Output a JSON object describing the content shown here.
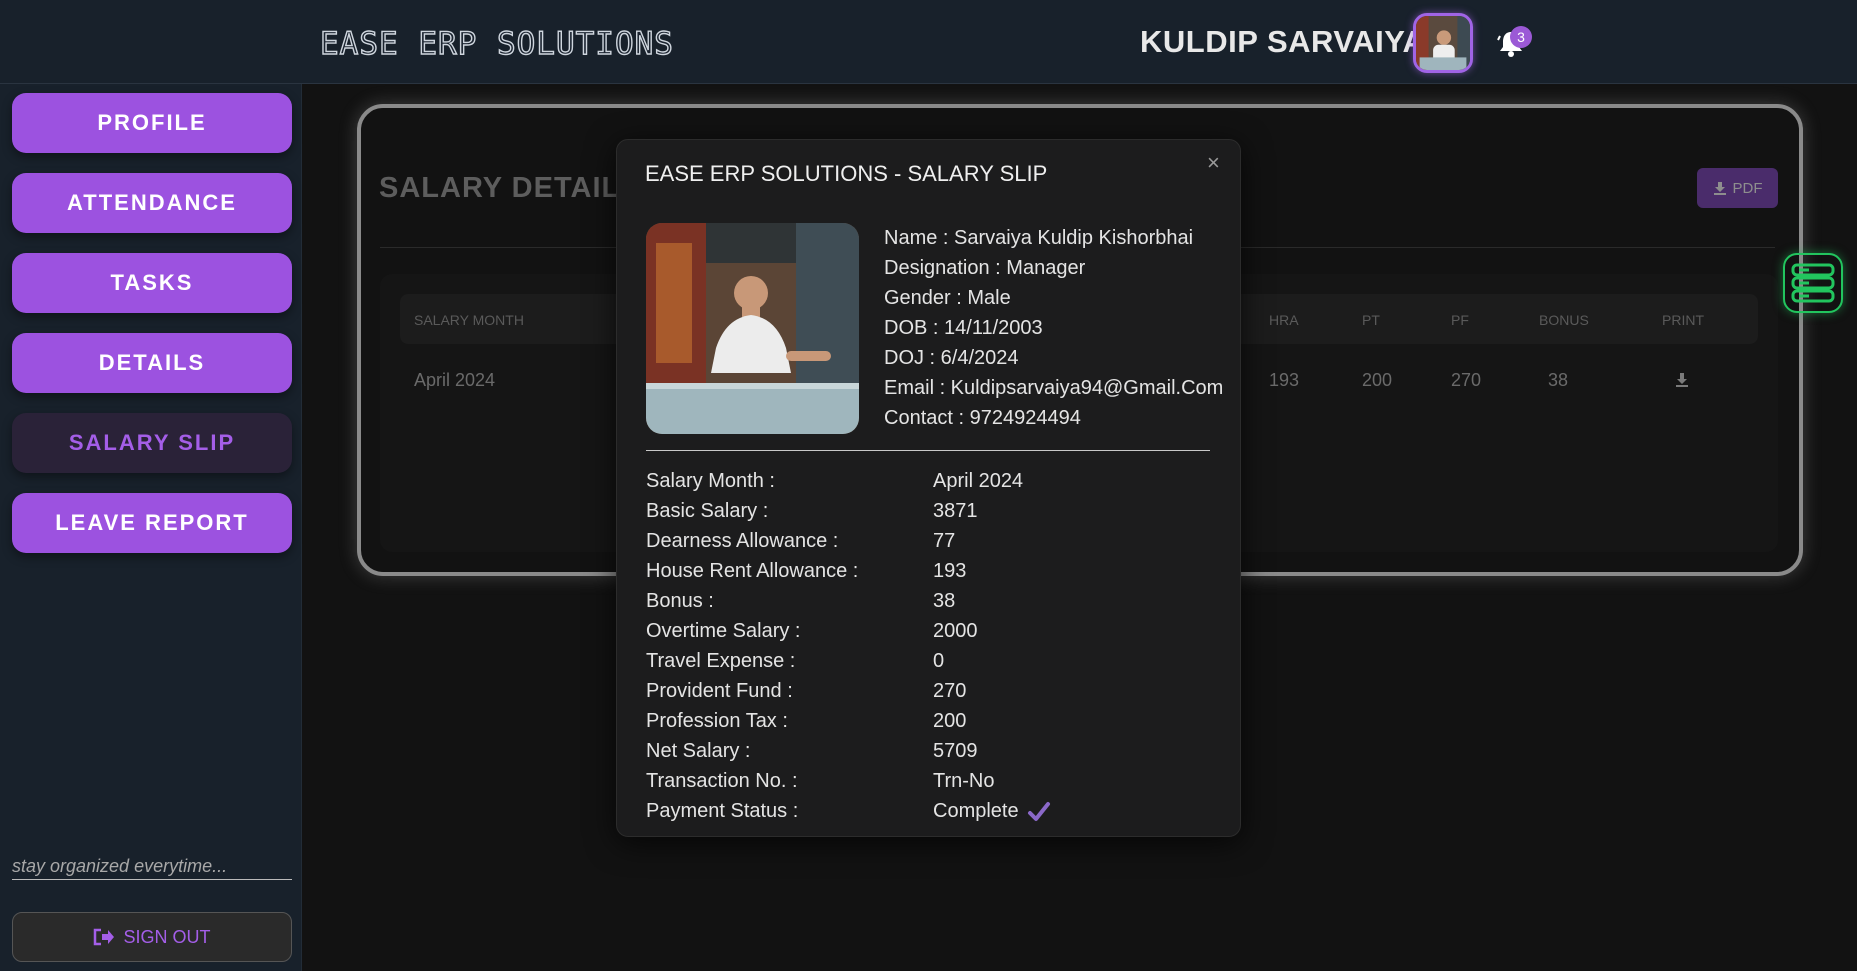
{
  "header": {
    "logo": "EASE ERP SOLUTIONS",
    "username": "KULDIP SARVAIYA",
    "notification_count": "3"
  },
  "sidebar": {
    "items": [
      {
        "label": "PROFILE"
      },
      {
        "label": "ATTENDANCE"
      },
      {
        "label": "TASKS"
      },
      {
        "label": "DETAILS"
      },
      {
        "label": "SALARY SLIP"
      },
      {
        "label": "LEAVE REPORT"
      }
    ],
    "tagline": "stay organized everytime...",
    "signout": "SIGN OUT"
  },
  "main": {
    "title": "SALARY DETAILS",
    "pdf_label": "PDF",
    "columns": [
      "SALARY MONTH",
      "HRA",
      "PT",
      "PF",
      "BONUS",
      "PRINT"
    ],
    "row": {
      "month": "April 2024",
      "hra": "193",
      "pt": "200",
      "pf": "270",
      "bonus": "38"
    }
  },
  "modal": {
    "title": "EASE ERP SOLUTIONS - SALARY SLIP",
    "close": "×",
    "info": [
      "Name : Sarvaiya Kuldip Kishorbhai",
      "Designation : Manager",
      "Gender : Male",
      "DOB : 14/11/2003",
      "DOJ : 6/4/2024",
      "Email : Kuldipsarvaiya94@Gmail.Com",
      "Contact : 9724924494"
    ],
    "rows": [
      {
        "label": "Salary Month :",
        "value": "April 2024"
      },
      {
        "label": "Basic Salary :",
        "value": "3871"
      },
      {
        "label": "Dearness Allowance :",
        "value": "77"
      },
      {
        "label": "House Rent Allowance :",
        "value": "193"
      },
      {
        "label": "Bonus :",
        "value": "38"
      },
      {
        "label": "Overtime Salary :",
        "value": "2000"
      },
      {
        "label": "Travel Expense :",
        "value": "0"
      },
      {
        "label": "Provident Fund :",
        "value": "270"
      },
      {
        "label": "Profession Tax :",
        "value": "200"
      },
      {
        "label": "Net Salary :",
        "value": "5709"
      },
      {
        "label": "Transaction No. :",
        "value": "Trn-No"
      },
      {
        "label": "Payment Status :",
        "value": "Complete"
      }
    ]
  },
  "colors": {
    "accent": "#9c52e0",
    "green": "#22c55e"
  }
}
